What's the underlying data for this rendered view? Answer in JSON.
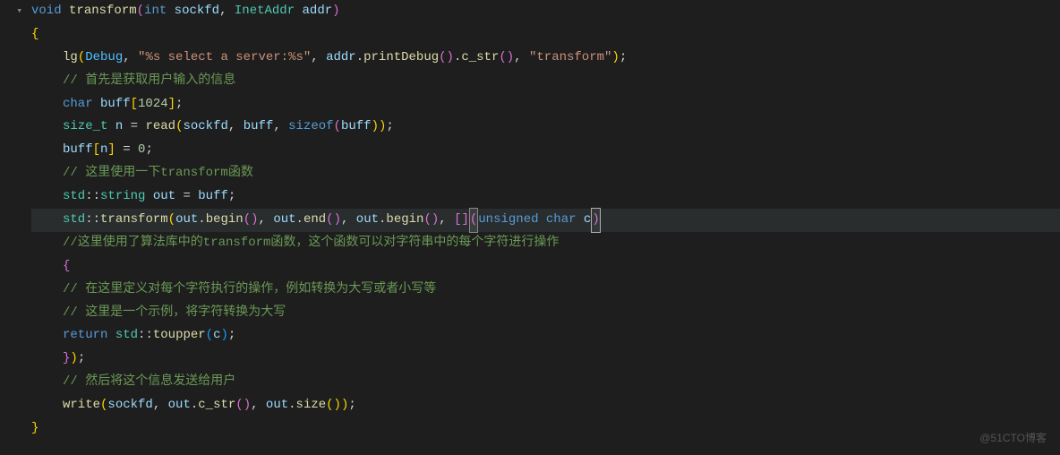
{
  "gutter": {
    "fold": "▾"
  },
  "code": {
    "l1": {
      "kw_void": "void",
      "func": "transform",
      "p1": "(",
      "kw_int": "int",
      "param1": " sockfd",
      "comma": ", ",
      "type": "InetAddr",
      "param2": " addr",
      "p2": ")"
    },
    "l2": {
      "brace": "{"
    },
    "l3": {
      "func": "lg",
      "p1": "(",
      "enum": "Debug",
      "c1": ", ",
      "str1": "\"%s select a server:%s\"",
      "c2": ", ",
      "var1": "addr",
      "dot1": ".",
      "func2": "printDebug",
      "p2": "()",
      "dot2": ".",
      "func3": "c_str",
      "p3": "()",
      "c3": ", ",
      "str2": "\"transform\"",
      "p4": ")",
      "semi": ";"
    },
    "l4": {
      "comment": "// 首先是获取用户输入的信息"
    },
    "l5": {
      "kw": "char",
      "var": " buff",
      "br1": "[",
      "num": "1024",
      "br2": "]",
      "semi": ";"
    },
    "l6": {
      "type": "size_t",
      "var": " n",
      "eq": " = ",
      "func": "read",
      "p1": "(",
      "v1": "sockfd",
      "c1": ", ",
      "v2": "buff",
      "c2": ", ",
      "kw": "sizeof",
      "p2": "(",
      "v3": "buff",
      "p3": "))",
      "semi": ";"
    },
    "l7": {
      "var": "buff",
      "br1": "[",
      "v2": "n",
      "br2": "]",
      "eq": " = ",
      "num": "0",
      "semi": ";"
    },
    "l8": {
      "comment": "// 这里使用一下transform函数"
    },
    "l9": {
      "ns": "std",
      "sc": "::",
      "type": "string",
      "var": " out",
      "eq": " = ",
      "v2": "buff",
      "semi": ";"
    },
    "l10": {
      "ns": "std",
      "sc": "::",
      "func": "transform",
      "p1": "(",
      "v1": "out",
      "dot1": ".",
      "m1": "begin",
      "pp1": "()",
      "c1": ", ",
      "v2": "out",
      "dot2": ".",
      "m2": "end",
      "pp2": "()",
      "c2": ", ",
      "v3": "out",
      "dot3": ".",
      "m3": "begin",
      "pp3": "()",
      "c3": ", ",
      "lambda": "[]",
      "lp1": "(",
      "kw": "unsigned",
      "sp": " ",
      "kw2": "char",
      "param": " c",
      "lp2": ")"
    },
    "l11": {
      "comment": "//这里使用了算法库中的transform函数，这个函数可以对字符串中的每个字符进行操作"
    },
    "l12": {
      "brace": "{"
    },
    "l13": {
      "comment": "// 在这里定义对每个字符执行的操作，例如转换为大写或者小写等"
    },
    "l14": {
      "comment": "// 这里是一个示例，将字符转换为大写"
    },
    "l15": {
      "kw": "return",
      "sp": " ",
      "ns": "std",
      "sc": "::",
      "func": "toupper",
      "p1": "(",
      "v1": "c",
      "p2": ")",
      "semi": ";"
    },
    "l16": {
      "brace": "}",
      "p": ")",
      "semi": ";"
    },
    "l17": {
      "comment": "// 然后将这个信息发送给用户"
    },
    "l18": {
      "func": "write",
      "p1": "(",
      "v1": "sockfd",
      "c1": ", ",
      "v2": "out",
      "dot1": ".",
      "m1": "c_str",
      "pp1": "()",
      "c2": ", ",
      "v3": "out",
      "dot2": ".",
      "m2": "size",
      "pp2": "())",
      "semi": ";"
    },
    "l19": {
      "brace": "}"
    }
  },
  "watermark": "@51CTO博客"
}
